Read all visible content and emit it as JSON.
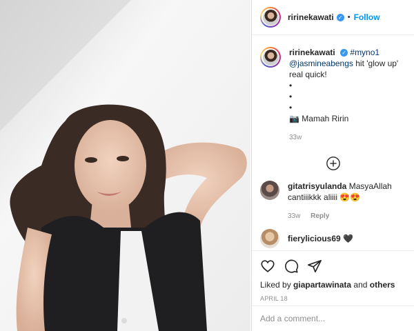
{
  "post": {
    "author": "ririnekawati",
    "follow_label": "Follow",
    "separator": "•"
  },
  "caption": {
    "username": "ririnekawati",
    "hashtag": "#myno1",
    "mention": "@jasmineabengs",
    "text": "hit 'glow up' real quick!",
    "bullets": [
      "•",
      "•",
      "•"
    ],
    "signature": "Mamah Ririn",
    "signature_icon": "camera-emoji",
    "time": "33w"
  },
  "comments": [
    {
      "username": "gitatrisyulanda",
      "text": "MasyaAllah cantiiikkk aliiii",
      "emoji": "😍😍",
      "time": "33w",
      "reply_label": "Reply"
    },
    {
      "username": "fierylicious69",
      "emoji": "🖤"
    }
  ],
  "likes": {
    "prefix": "Liked by",
    "user": "giapartawinata",
    "joiner": "and",
    "others": "others"
  },
  "date": "APRIL 18",
  "add_comment": {
    "placeholder": "Add a comment..."
  },
  "colors": {
    "accent": "#0095f6",
    "verified": "#3897f0",
    "muted": "#8e8e8e"
  }
}
